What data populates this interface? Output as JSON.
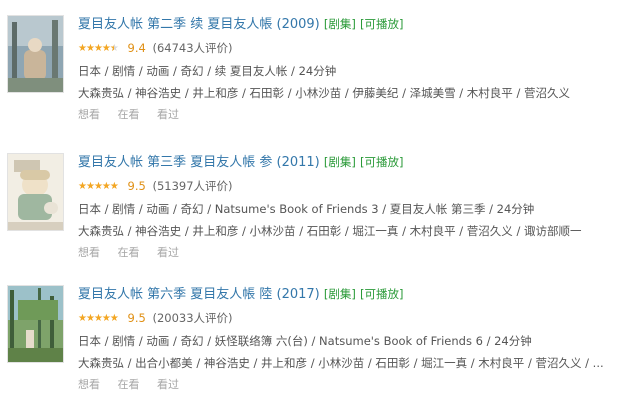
{
  "items": [
    {
      "title": "夏目友人帐 第二季 续 夏目友人帳 (2009)",
      "tag_series": "[剧集]",
      "tag_play": "[可播放]",
      "rating": 9.4,
      "score": "9.4",
      "count": "(64743人评价)",
      "meta": "日本 / 剧情 / 动画 / 奇幻 / 续 夏目友人帐 / 24分钟",
      "cast": "大森贵弘 / 神谷浩史 / 井上和彦 / 石田彰 / 小林沙苗 / 伊藤美纪 / 泽城美雪 / 木村良平 / 菅沼久义",
      "actions": [
        "想看",
        "在看",
        "看过"
      ]
    },
    {
      "title": "夏目友人帐 第三季 夏目友人帳 参 (2011)",
      "tag_series": "[剧集]",
      "tag_play": "[可播放]",
      "rating": 9.5,
      "score": "9.5",
      "count": "(51397人评价)",
      "meta": "日本 / 剧情 / 动画 / 奇幻 / Natsume's Book of Friends 3 / 夏目友人帐 第三季 / 24分钟",
      "cast": "大森贵弘 / 神谷浩史 / 井上和彦 / 小林沙苗 / 石田彰 / 堀江一真 / 木村良平 / 菅沼久义 / 诹访部顺一",
      "actions": [
        "想看",
        "在看",
        "看过"
      ]
    },
    {
      "title": "夏目友人帐 第六季 夏目友人帳 陸 (2017)",
      "tag_series": "[剧集]",
      "tag_play": "[可播放]",
      "rating": 9.5,
      "score": "9.5",
      "count": "(20033人评价)",
      "meta": "日本 / 剧情 / 动画 / 奇幻 / 妖怪联络簿 六(台) / Natsume's Book of Friends 6 / 24分钟",
      "cast": "大森贵弘 / 出合小都美 / 神谷浩史 / 井上和彦 / 小林沙苗 / 石田彰 / 堀江一真 / 木村良平 / 菅沼久义 / ...",
      "actions": [
        "想看",
        "在看",
        "看过"
      ]
    }
  ],
  "colors": {
    "title": "#3377aa",
    "tag": "#2a9a38",
    "star": "#f3a623",
    "muted": "#a6a6a6"
  }
}
